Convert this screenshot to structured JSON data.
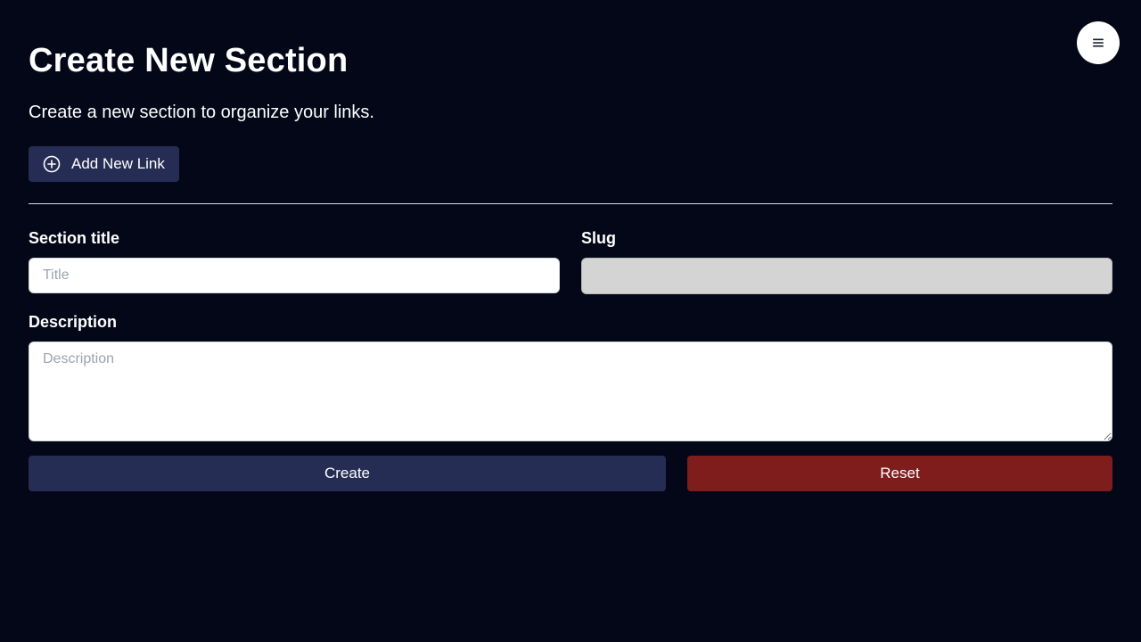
{
  "page": {
    "title": "Create New Section",
    "subtitle": "Create a new section to organize your links."
  },
  "toolbar": {
    "add_link_label": "Add New Link",
    "add_link_icon": "plus-circle-icon",
    "menu_icon": "hamburger-menu-icon"
  },
  "form": {
    "section_title_label": "Section title",
    "title_placeholder": "Title",
    "title_value": "",
    "slug_label": "Slug",
    "slug_value": "",
    "description_label": "Description",
    "description_placeholder": "Description",
    "description_value": "",
    "create_label": "Create",
    "reset_label": "Reset"
  },
  "colors": {
    "background": "#030717",
    "primary_button": "#262d55",
    "danger_button": "#7f1d1d",
    "disabled_field": "#d4d4d4"
  }
}
